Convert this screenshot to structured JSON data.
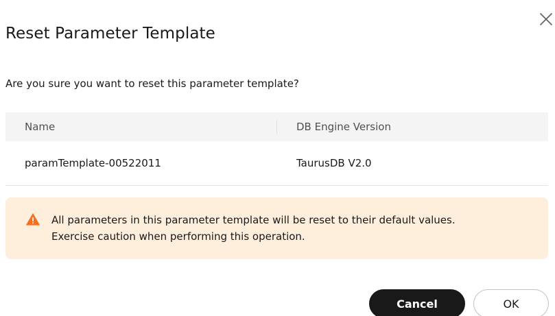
{
  "dialog": {
    "title": "Reset Parameter Template",
    "confirm_text": "Are you sure you want to reset this parameter template?",
    "close_icon": "close-icon"
  },
  "table": {
    "headers": {
      "name": "Name",
      "version": "DB Engine Version"
    },
    "rows": [
      {
        "name": "paramTemplate-00522011",
        "version": "TaurusDB V2.0"
      }
    ]
  },
  "alert": {
    "icon": "warning-icon",
    "line1": "All parameters in this parameter template will be reset to their default values.",
    "line2": "Exercise caution when performing this operation.",
    "background_color": "#feeedc",
    "icon_color": "#f66f1c"
  },
  "buttons": {
    "cancel_label": "Cancel",
    "ok_label": "OK"
  }
}
